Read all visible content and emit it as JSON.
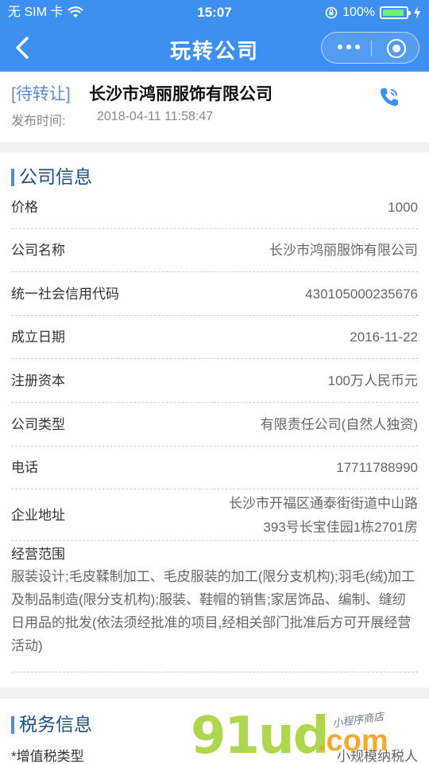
{
  "status": {
    "carrier": "无 SIM 卡",
    "time": "15:07",
    "battery": "100%"
  },
  "nav": {
    "title": "玩转公司"
  },
  "header": {
    "tag": "[待转让]",
    "company": "长沙市鸿丽服饰有限公司",
    "publish_label": "发布时间:",
    "publish_time": "2018-04-11 11:58:47"
  },
  "company_info": {
    "title": "公司信息",
    "rows": [
      {
        "label": "价格",
        "value": "1000"
      },
      {
        "label": "公司名称",
        "value": "长沙市鸿丽服饰有限公司"
      },
      {
        "label": "统一社会信用代码",
        "value": "430105000235676"
      },
      {
        "label": "成立日期",
        "value": "2016-11-22"
      },
      {
        "label": "注册资本",
        "value": "100万人民币元"
      },
      {
        "label": "公司类型",
        "value": "有限责任公司(自然人独资)"
      },
      {
        "label": "电话",
        "value": "17711788990"
      },
      {
        "label": "企业地址",
        "value_line1": "长沙市开福区通泰街街道中山路",
        "value_line2": "393号长宝佳园1栋2701房"
      }
    ],
    "scope_label": "经营范围",
    "scope_text": "服装设计;毛皮鞣制加工、毛皮服装的加工(限分支机构);羽毛(绒)加工及制品制造(限分支机构);服装、鞋帽的销售;家居饰品、编制、缝纫日用品的批发(依法须经批准的项目,经相关部门批准后方可开展经营活动)"
  },
  "tax_info": {
    "title": "税务信息",
    "vat_label": "*增值税类型",
    "vat_value": "小规模纳税人"
  },
  "watermark": {
    "big": "91ud",
    "dotcom": ".com",
    "small": "小程序商店"
  }
}
